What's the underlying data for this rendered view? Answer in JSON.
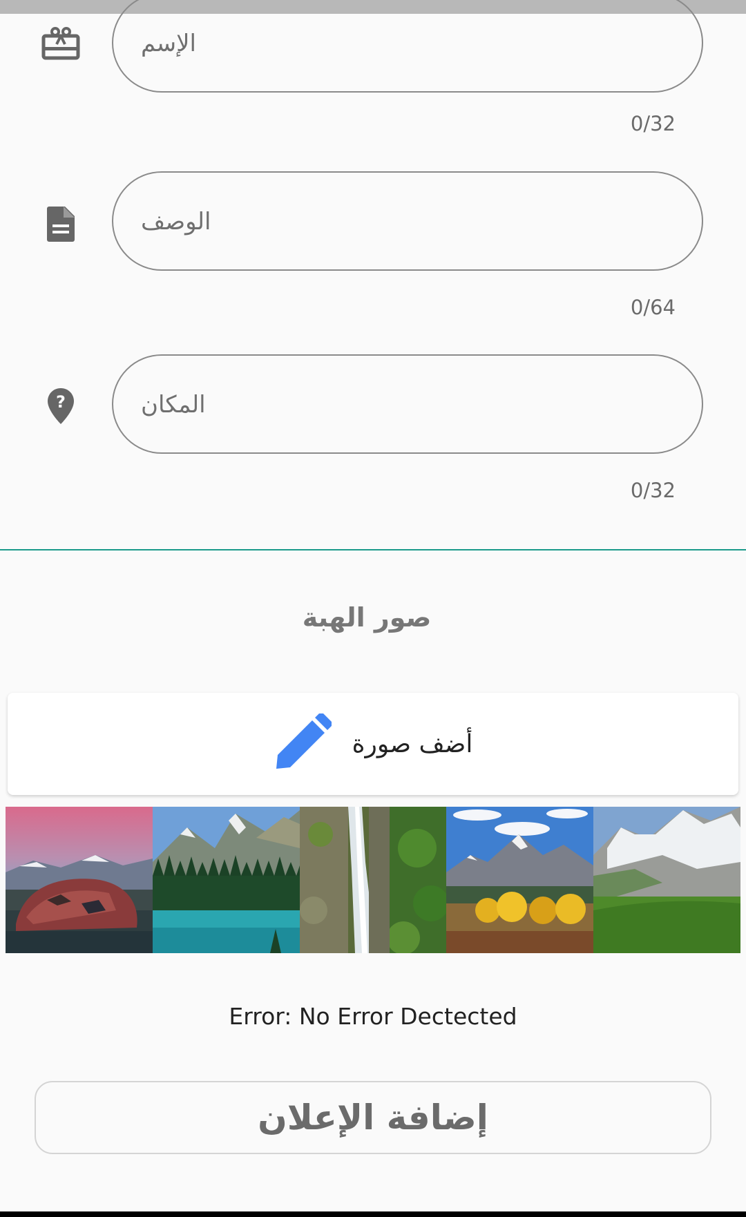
{
  "form": {
    "fields": [
      {
        "icon": "gift-card-icon",
        "placeholder": "الإسم",
        "counter": "0/32"
      },
      {
        "icon": "document-icon",
        "placeholder": "الوصف",
        "counter": "0/64"
      },
      {
        "icon": "location-unknown-icon",
        "placeholder": "المكان",
        "counter": "0/32"
      }
    ]
  },
  "images_section": {
    "title": "صور الهبة",
    "add_button_label": "أضف صورة",
    "add_button_icon": "pencil-icon",
    "icon_color": "#4285f4"
  },
  "gallery": {
    "thumbnails": [
      {
        "alt": "rock by mountain lake at sunset"
      },
      {
        "alt": "turquoise lake with pine forest and mountains"
      },
      {
        "alt": "waterfall on mossy cliff"
      },
      {
        "alt": "autumn aspens below mountains"
      },
      {
        "alt": "snowy mountain above green valley"
      }
    ]
  },
  "status": {
    "error_text": "Error: No Error Dectected"
  },
  "submit": {
    "label": "إضافة الإعلان"
  },
  "colors": {
    "divider": "#1a9a8a",
    "field_border": "#8a8a8a"
  }
}
